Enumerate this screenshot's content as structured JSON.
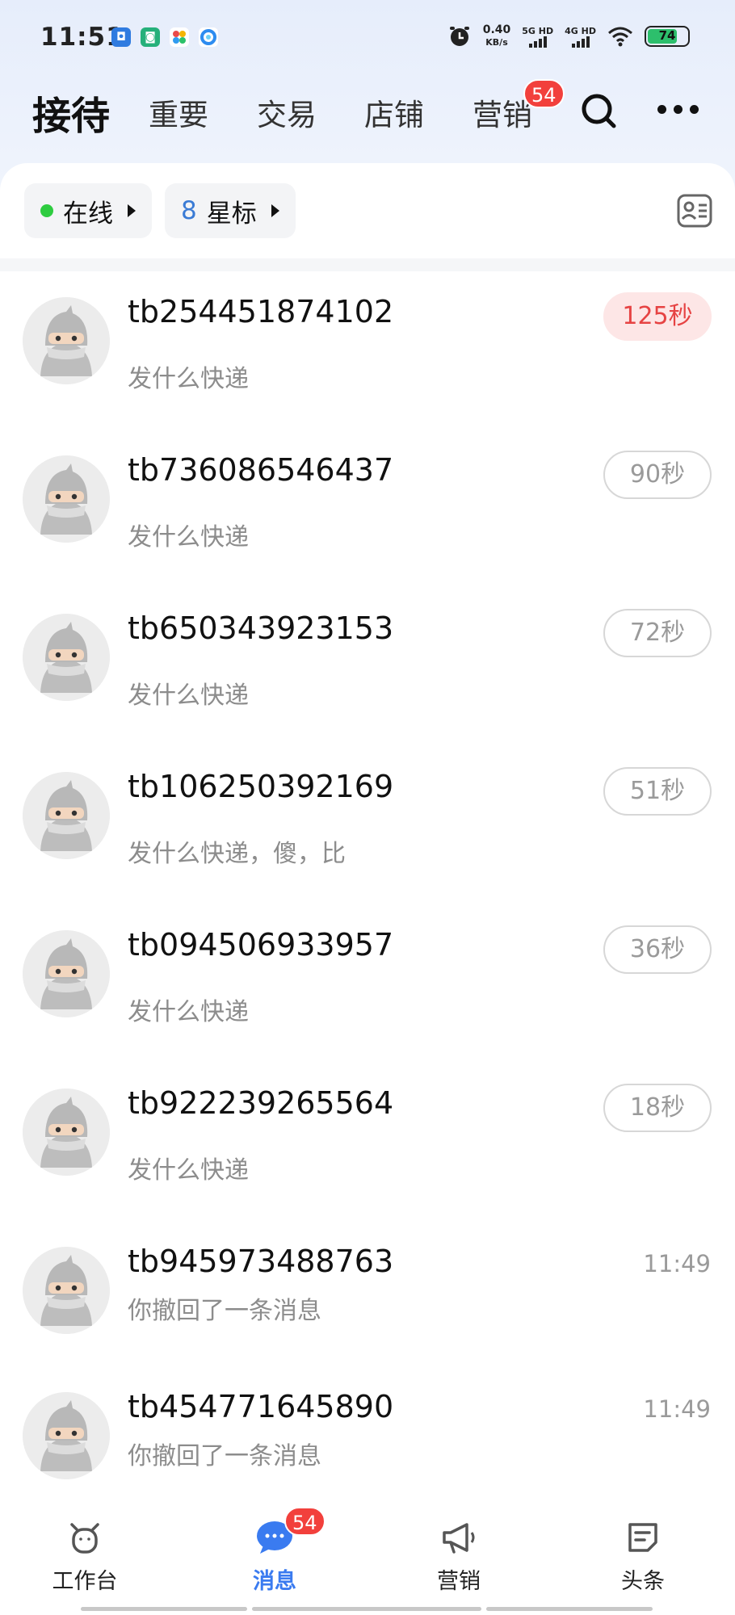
{
  "status_bar": {
    "time": "11:51",
    "speed_value": "0.40",
    "speed_unit": "KB/s",
    "sim1": "5G HD",
    "sim2": "4G HD",
    "battery": "74"
  },
  "tabs": {
    "active": "接待",
    "items": [
      "重要",
      "交易",
      "店铺",
      "营销"
    ],
    "marketing_badge": "54"
  },
  "filters": {
    "online_label": "在线",
    "star_count": "8",
    "star_label": "星标"
  },
  "conversations": [
    {
      "name": "tb254451874102",
      "message": "发什么快递",
      "timer": "125秒",
      "urgent": true
    },
    {
      "name": "tb736086546437",
      "message": "发什么快递",
      "timer": "90秒"
    },
    {
      "name": "tb650343923153",
      "message": "发什么快递",
      "timer": "72秒"
    },
    {
      "name": "tb106250392169",
      "message": "发什么快递，傻，比",
      "timer": "51秒"
    },
    {
      "name": "tb094506933957",
      "message": "发什么快递",
      "timer": "36秒"
    },
    {
      "name": "tb922239265564",
      "message": "发什么快递",
      "timer": "18秒"
    },
    {
      "name": "tb945973488763",
      "message": "你撤回了一条消息",
      "time": "11:49"
    },
    {
      "name": "tb454771645890",
      "message": "你撤回了一条消息",
      "time": "11:49"
    }
  ],
  "bottom_nav": {
    "items": [
      "工作台",
      "消息",
      "营销",
      "头条"
    ],
    "messages_badge": "54"
  },
  "colors": {
    "accent_blue": "#3a7bf0",
    "badge_red": "#f2403c",
    "online_green": "#2ecc40",
    "urgent_red": "#e64343"
  }
}
